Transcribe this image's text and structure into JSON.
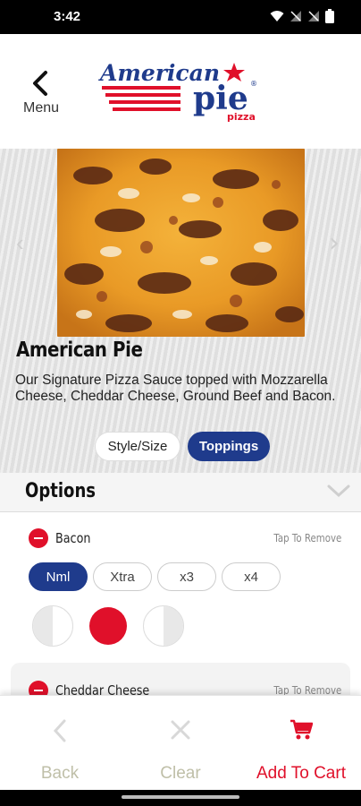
{
  "status_bar": {
    "time": "3:42",
    "icons": [
      "wifi-icon",
      "no-signal-icon",
      "no-signal-icon",
      "battery-icon"
    ]
  },
  "header": {
    "menu_label": "Menu",
    "logo": {
      "line1": "American",
      "line2": "pie",
      "tagline": "pizza",
      "trademark": "®"
    },
    "colors": {
      "brand_red": "#e0102a",
      "brand_blue": "#1f3b8c"
    }
  },
  "item": {
    "name": "American Pie",
    "description": "Our Signature Pizza Sauce topped with Mozzarella Cheese, Cheddar Cheese, Ground Beef and Bacon.",
    "tabs": [
      {
        "label": "Style/Size",
        "selected": false
      },
      {
        "label": "Toppings",
        "selected": true
      }
    ]
  },
  "options": {
    "title": "Options",
    "toppings": [
      {
        "name": "Bacon",
        "remove_hint": "Tap To Remove",
        "amounts": [
          "Nml",
          "Xtra",
          "x3",
          "x4"
        ],
        "selected_amount": "Nml",
        "placements": [
          "left-half",
          "whole",
          "right-half"
        ],
        "selected_placement": "whole"
      },
      {
        "name": "Cheddar Cheese",
        "remove_hint": "Tap To Remove"
      }
    ]
  },
  "bottom_bar": {
    "back_label": "Back",
    "clear_label": "Clear",
    "cart_label": "Add To Cart"
  }
}
